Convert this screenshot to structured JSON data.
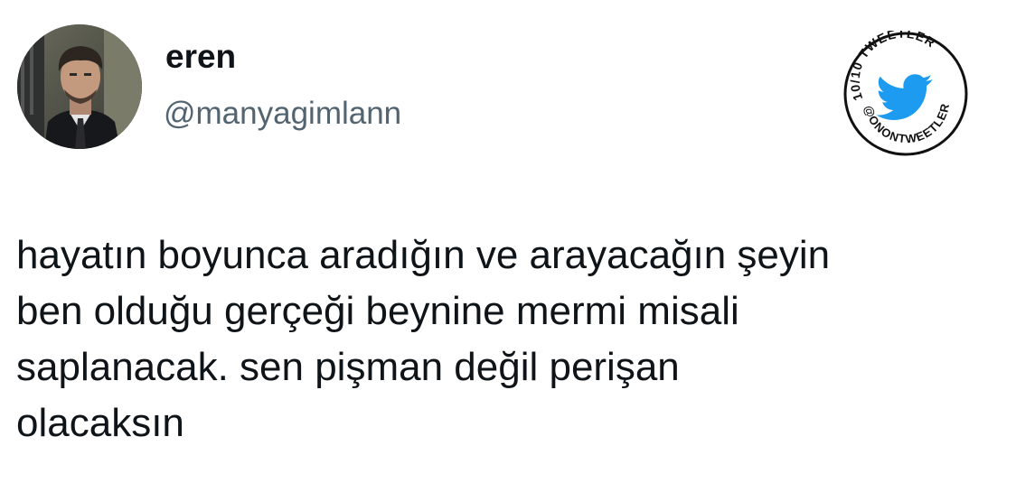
{
  "author": {
    "display_name": "eren",
    "handle": "@manyagimlann",
    "avatar_icon": "profile-photo"
  },
  "badge": {
    "top_text": "10/10 TWEETLER",
    "bottom_text": "@ONONTWEETLER",
    "icon": "twitter-bird-icon",
    "bird_color": "#1d9bf0"
  },
  "tweet": {
    "lines": [
      "hayatın boyunca aradığın ve arayacağın şeyin",
      "ben olduğu gerçeği beynine mermi misali",
      "saplanacak. sen pişman değil perişan",
      "olacaksın"
    ]
  },
  "colors": {
    "text_primary": "#0f1419",
    "text_secondary": "#536471",
    "background": "#ffffff"
  }
}
